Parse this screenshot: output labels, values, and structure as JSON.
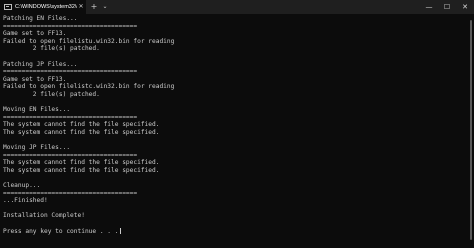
{
  "window": {
    "tab_title": "C:\\WINDOWS\\system32\\cmd.",
    "tab_close": "✕",
    "new_tab": "+",
    "dropdown": "⌄",
    "minimize": "—",
    "maximize": "☐",
    "close": "✕"
  },
  "console": {
    "lines": [
      "Patching EN Files...",
      "====================================",
      "Game set to FF13.",
      "Failed to open filelistu.win32.bin for reading",
      "        2 file(s) patched.",
      "",
      "Patching JP Files...",
      "====================================",
      "Game set to FF13.",
      "Failed to open filelistc.win32.bin for reading",
      "        2 file(s) patched.",
      "",
      "Moving EN Files...",
      "====================================",
      "The system cannot find the file specified.",
      "The system cannot find the file specified.",
      "",
      "Moving JP Files...",
      "====================================",
      "The system cannot find the file specified.",
      "The system cannot find the file specified.",
      "",
      "Cleanup...",
      "====================================",
      "...Finished!",
      "",
      "Installation Complete!",
      "",
      "Press any key to continue . . ."
    ]
  },
  "colors": {
    "background": "#0c0c0c",
    "text": "#cccccc",
    "titlebar": "#1f1f1f"
  },
  "icons": {
    "tab_icon": "terminal-icon"
  }
}
